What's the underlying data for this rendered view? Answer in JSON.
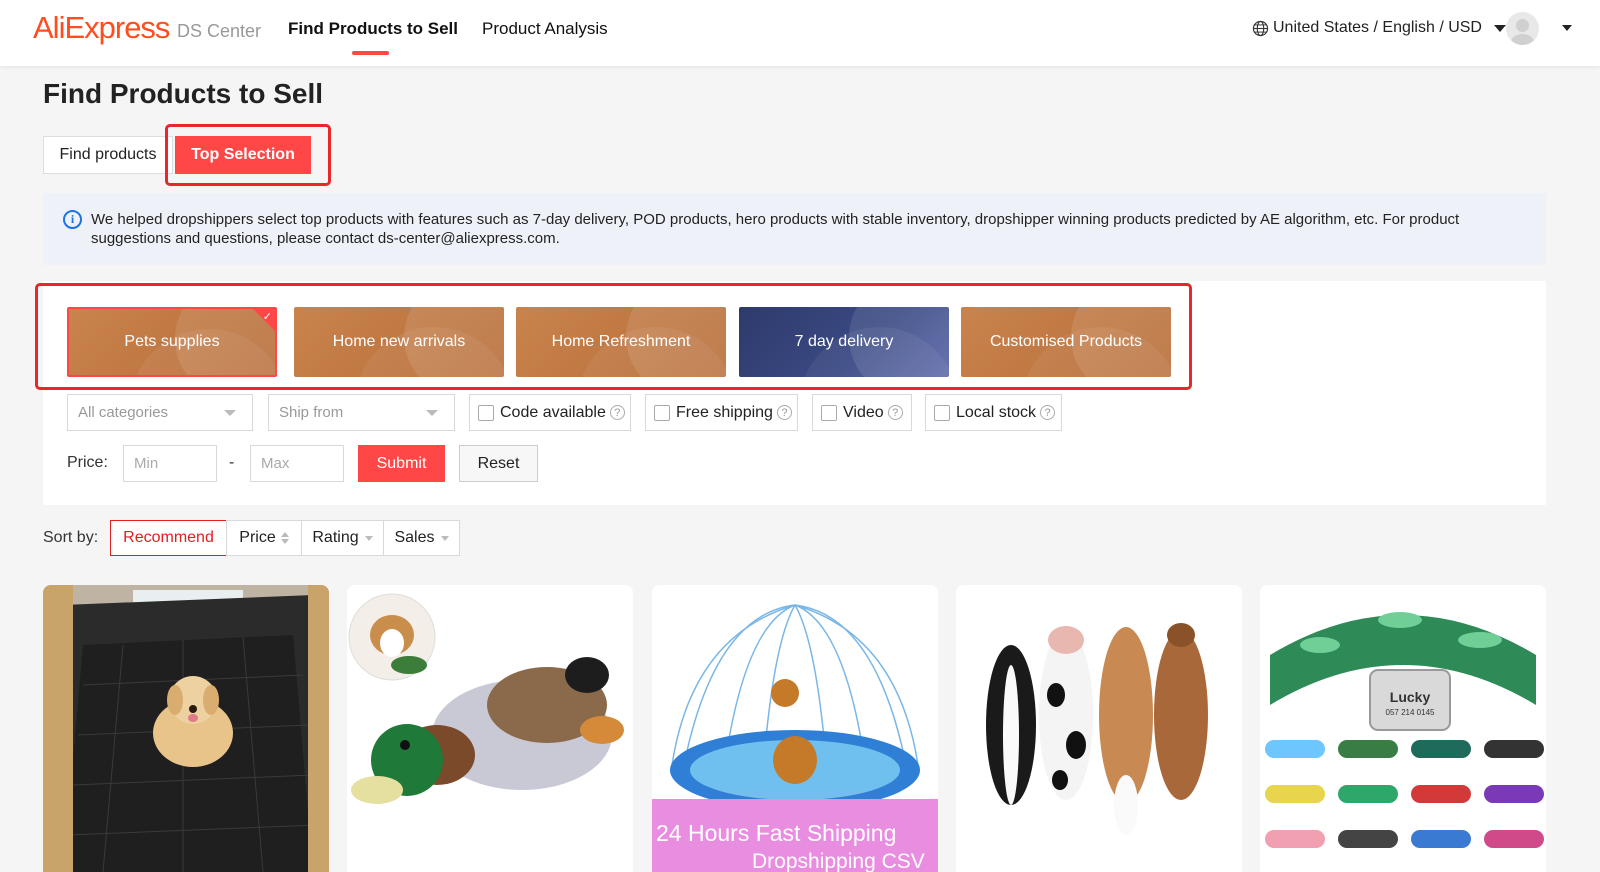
{
  "header": {
    "logo_ali": "Ali",
    "logo_express": "Express",
    "logo_sub": "DS Center",
    "nav": [
      {
        "label": "Find Products to Sell"
      },
      {
        "label": "Product Analysis"
      }
    ],
    "locale": "United States / English / USD"
  },
  "page_title": "Find Products to Sell",
  "tabs": [
    {
      "label": "Find products"
    },
    {
      "label": "Top Selection"
    }
  ],
  "info_text": "We helped dropshippers select top products with features such as 7-day delivery, POD products, hero products with stable inventory, dropshipper winning products predicted by AE algorithm, etc. For product suggestions and questions, please contact ds-center@aliexpress.com.",
  "categories": [
    {
      "label": "Pets supplies",
      "selected": true
    },
    {
      "label": "Home new arrivals"
    },
    {
      "label": "Home Refreshment"
    },
    {
      "label": "7 day delivery"
    },
    {
      "label": "Customised Products"
    }
  ],
  "filters": {
    "category_select": "All categories",
    "ship_from_select": "Ship from",
    "checkboxes": [
      {
        "label": "Code available",
        "checked": false
      },
      {
        "label": "Free shipping",
        "checked": false
      },
      {
        "label": "Video",
        "checked": false
      },
      {
        "label": "Local stock",
        "checked": false
      }
    ],
    "price_label": "Price:",
    "min_placeholder": "Min",
    "max_placeholder": "Max",
    "dash": "-",
    "submit_label": "Submit",
    "reset_label": "Reset"
  },
  "sort": {
    "label": "Sort by:",
    "options": [
      {
        "label": "Recommend",
        "active": true
      },
      {
        "label": "Price"
      },
      {
        "label": "Rating"
      },
      {
        "label": "Sales"
      }
    ]
  },
  "products": [
    {
      "image": "dog-car-seat-cover"
    },
    {
      "image": "duck-plush-toy"
    },
    {
      "image": "dog-splash-pad",
      "banner_text": "24 Hours Fast Shipping",
      "banner_text2": "Dropshipping CSV"
    },
    {
      "image": "squeaky-animal-toys"
    },
    {
      "image": "personalized-dog-collar",
      "tag_name": "Lucky",
      "tag_number": "057 214 0145"
    }
  ],
  "colors": {
    "accent": "#ff4747",
    "brand": "#ff4e1d",
    "card_orange": "#c17a44",
    "card_navy": "#35417a",
    "highlight_box": "#e8262b"
  }
}
